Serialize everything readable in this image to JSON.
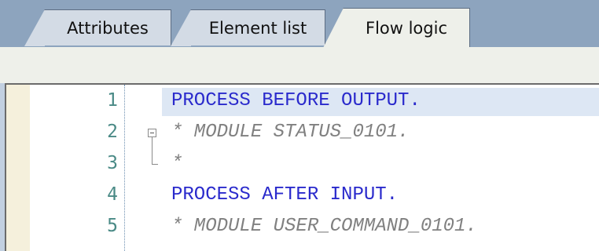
{
  "tabs": [
    {
      "label": "Attributes",
      "active": false
    },
    {
      "label": "Element list",
      "active": false
    },
    {
      "label": "Flow logic",
      "active": true
    }
  ],
  "editor": {
    "lines": [
      {
        "number": "1",
        "text": "PROCESS BEFORE OUTPUT.",
        "kind": "keyword",
        "current": true
      },
      {
        "number": "2",
        "text": "* MODULE STATUS_0101.",
        "kind": "comment",
        "fold": "start"
      },
      {
        "number": "3",
        "text": "*",
        "kind": "comment",
        "fold": "end"
      },
      {
        "number": "4",
        "text": "PROCESS AFTER INPUT.",
        "kind": "keyword"
      },
      {
        "number": "5",
        "text": "* MODULE USER_COMMAND_0101.",
        "kind": "comment"
      }
    ]
  },
  "colors": {
    "keyword": "#2a2acc",
    "comment": "#808080",
    "line_number": "#4a8a86",
    "current_line": "#dde7f4",
    "tab_strip": "#8da4be"
  },
  "icons": {
    "fold": "collapse-minus-icon"
  }
}
